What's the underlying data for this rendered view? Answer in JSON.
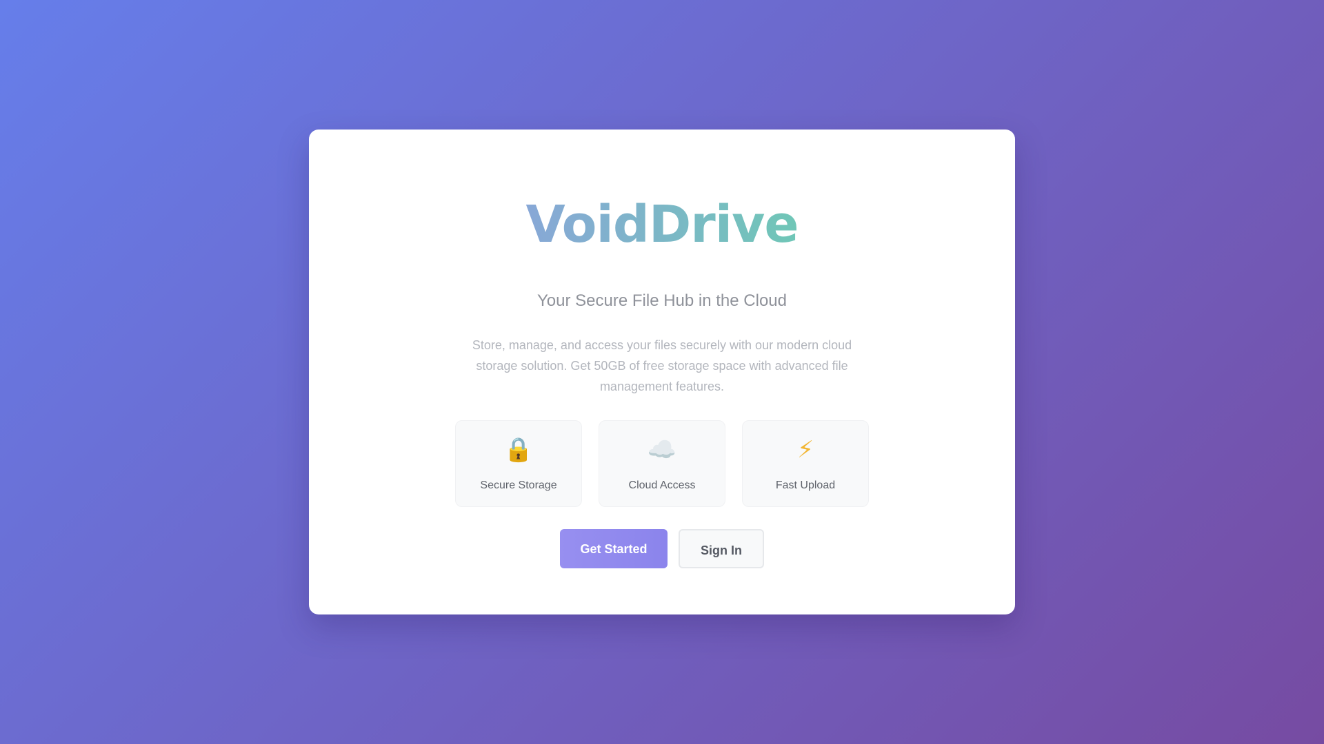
{
  "brand": {
    "name": "VoidDrive"
  },
  "hero": {
    "tagline": "Your Secure File Hub in the Cloud",
    "description": "Store, manage, and access your files securely with our modern cloud storage solution. Get 50GB of free storage space with advanced file management features."
  },
  "features": [
    {
      "icon": "lock-icon",
      "glyph": "🔒",
      "label": "Secure Storage"
    },
    {
      "icon": "cloud-icon",
      "glyph": "☁️",
      "label": "Cloud Access"
    },
    {
      "icon": "lightning-icon",
      "glyph": "⚡",
      "label": "Fast Upload"
    }
  ],
  "actions": {
    "get_started_label": "Get Started",
    "sign_in_label": "Sign In"
  },
  "colors": {
    "background_start": "#667eea",
    "background_end": "#764ba2",
    "primary_button": "#908aef",
    "logo_gradient_start": "#9b8ff0",
    "logo_gradient_end": "#5fd1b0"
  }
}
